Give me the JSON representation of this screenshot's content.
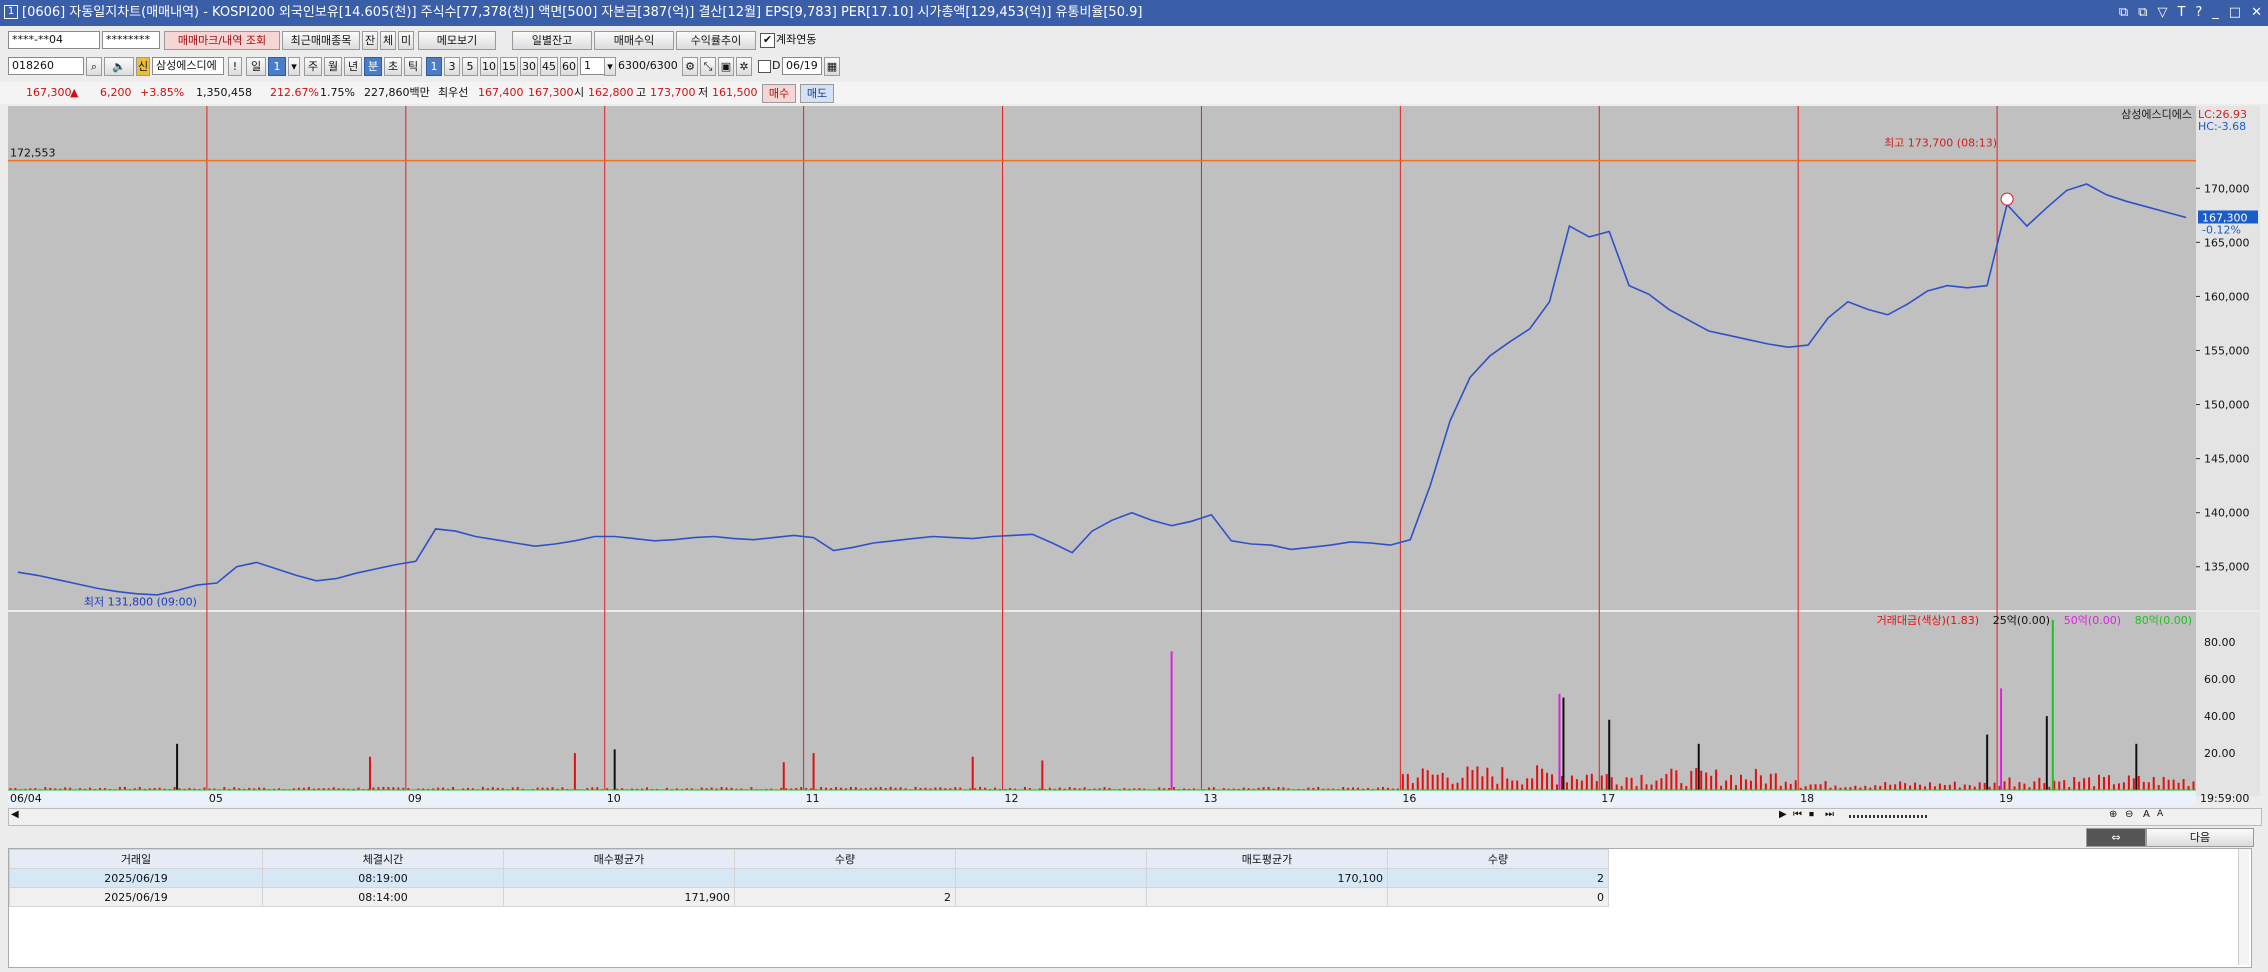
{
  "window": {
    "title": "[0606] 자동일지차트(매매내역) - KOSPI200 외국인보유[14.605(천)] 주식수[77,378(천)] 액면[500] 자본금[387(억)] 결산[12월] EPS[9,783] PER[17.10] 시가총액[129,453(억)] 유통비율[50.9]",
    "icon": "1",
    "buttons": [
      "⧉",
      "⧉",
      "▽",
      "T",
      "?",
      "_",
      "□",
      "✕"
    ]
  },
  "toolbar1": {
    "account": "****-**04",
    "password": "********",
    "buttons": [
      "매매마크/내역 조회",
      "최근매매종목",
      "잔",
      "체",
      "미",
      "메모보기",
      "일별잔고",
      "매매수익",
      "수익률추이"
    ],
    "checkbox_label": "계좌연동",
    "checkbox_checked": true
  },
  "toolbar2": {
    "code": "018260",
    "stock_name": "삼성에스디에",
    "period_buttons": [
      "일",
      "1",
      "주",
      "월",
      "년",
      "분",
      "초",
      "틱"
    ],
    "active_period": "분",
    "interval_buttons": [
      "1",
      "3",
      "5",
      "10",
      "15",
      "30",
      "45",
      "60"
    ],
    "active_interval": "1",
    "multiplier": "1",
    "count": "6300",
    "count_total": "/6300",
    "date_checkbox_label": "D",
    "date": "06/19"
  },
  "quote": {
    "price": "167,300",
    "change_arrow": "▲",
    "change": "6,200",
    "change_pct": "+3.85%",
    "volume": "1,350,458",
    "vol_ratio": "212.67%",
    "turnover": "1.75%",
    "amount": "227,860백만",
    "pre_label": "최우선",
    "ask": "167,400",
    "bid": "167,300",
    "open_label": "시",
    "open": "162,800",
    "high_label": "고",
    "high": "173,700",
    "low_label": "저",
    "low": "161,500",
    "buy_btn": "매수",
    "sell_btn": "매도"
  },
  "chart_data": [
    {
      "type": "line",
      "title": "",
      "legend": "삼성에스디에스",
      "lc": "LC:26.93",
      "hc": "HC:-3.68",
      "hline_label": "172,553",
      "hline_value": 172553,
      "current_price_label": "167,300",
      "current_change_label": "-0.12%",
      "max_label": "최고 173,700 (08:13)",
      "min_label": "최저 131,800 (09:00)",
      "ylim": [
        131000,
        176500
      ],
      "yticks": [
        170000,
        165000,
        160000,
        155000,
        150000,
        145000,
        140000,
        135000
      ],
      "ytick_labels": [
        "170,000",
        "165,000",
        "160,000",
        "155,000",
        "150,000",
        "145,000",
        "140,000",
        "135,000"
      ],
      "x_labels": [
        "06/04",
        "05",
        "09",
        "10",
        "11",
        "12",
        "13",
        "16",
        "17",
        "18",
        "19"
      ],
      "time_label": "19:59:00",
      "line_color": "#3050C8",
      "day_series": [
        {
          "day": "06/04",
          "values": [
            134500,
            134200,
            133800,
            133400,
            133000,
            132700,
            132500,
            132400,
            132800,
            133300
          ]
        },
        {
          "day": "05",
          "values": [
            133500,
            135000,
            135400,
            134800,
            134200,
            133700,
            133900,
            134400,
            134800,
            135200
          ]
        },
        {
          "day": "09",
          "values": [
            135500,
            138500,
            138300,
            137800,
            137500,
            137200,
            136900,
            137100,
            137400,
            137800
          ]
        },
        {
          "day": "10",
          "values": [
            137800,
            137600,
            137400,
            137500,
            137700,
            137800,
            137600,
            137500,
            137700,
            137900
          ]
        },
        {
          "day": "11",
          "values": [
            137700,
            136500,
            136800,
            137200,
            137400,
            137600,
            137800,
            137700,
            137600,
            137800
          ]
        },
        {
          "day": "12",
          "values": [
            137900,
            138000,
            137200,
            136300,
            138300,
            139300,
            140000,
            139300,
            138800,
            139200
          ]
        },
        {
          "day": "13",
          "values": [
            139800,
            137400,
            137100,
            137000,
            136600,
            136800,
            137000,
            137300,
            137200,
            137000
          ]
        },
        {
          "day": "16",
          "values": [
            137500,
            142500,
            148500,
            152500,
            154500,
            155800,
            157000,
            159500,
            166500,
            165500
          ]
        },
        {
          "day": "17",
          "values": [
            166000,
            161000,
            160200,
            158800,
            157800,
            156800,
            156400,
            156000,
            155600,
            155300
          ]
        },
        {
          "day": "18",
          "values": [
            155500,
            158000,
            159500,
            158800,
            158300,
            159300,
            160500,
            161000,
            160800,
            161000
          ]
        },
        {
          "day": "19",
          "values": [
            168500,
            166500,
            168200,
            169800,
            170400,
            169400,
            168800,
            168300,
            167800,
            167300
          ]
        }
      ]
    },
    {
      "type": "bar",
      "title": "",
      "legend": [
        "거래대금(색상)(1.83)",
        "25억(0.00)",
        "50억(0.00)",
        "80억(0.00)"
      ],
      "legend_colors": [
        "#E01010",
        "#111111",
        "#E020E0",
        "#20C020"
      ],
      "ylim": [
        0,
        92
      ],
      "yticks": [
        80,
        60,
        40,
        20
      ],
      "ytick_labels": [
        "80.00",
        "60.00",
        "40.00",
        "20.00"
      ],
      "spikes": [
        {
          "day_idx": 0,
          "pos": 0.85,
          "value": 25,
          "color": "#111111"
        },
        {
          "day_idx": 1,
          "pos": 0.82,
          "value": 18,
          "color": "#E01010"
        },
        {
          "day_idx": 2,
          "pos": 0.85,
          "value": 20,
          "color": "#E01010"
        },
        {
          "day_idx": 3,
          "pos": 0.05,
          "value": 22,
          "color": "#111111"
        },
        {
          "day_idx": 3,
          "pos": 0.9,
          "value": 15,
          "color": "#E01010"
        },
        {
          "day_idx": 4,
          "pos": 0.05,
          "value": 20,
          "color": "#E01010"
        },
        {
          "day_idx": 4,
          "pos": 0.85,
          "value": 18,
          "color": "#E01010"
        },
        {
          "day_idx": 5,
          "pos": 0.2,
          "value": 16,
          "color": "#E01010"
        },
        {
          "day_idx": 5,
          "pos": 0.85,
          "value": 75,
          "color": "#E020E0"
        },
        {
          "day_idx": 7,
          "pos": 0.8,
          "value": 52,
          "color": "#E020E0"
        },
        {
          "day_idx": 7,
          "pos": 0.82,
          "value": 50,
          "color": "#111111"
        },
        {
          "day_idx": 8,
          "pos": 0.05,
          "value": 38,
          "color": "#111111"
        },
        {
          "day_idx": 8,
          "pos": 0.5,
          "value": 25,
          "color": "#111111"
        },
        {
          "day_idx": 9,
          "pos": 0.95,
          "value": 30,
          "color": "#111111"
        },
        {
          "day_idx": 10,
          "pos": 0.02,
          "value": 55,
          "color": "#E020E0"
        },
        {
          "day_idx": 10,
          "pos": 0.28,
          "value": 92,
          "color": "#20C020"
        },
        {
          "day_idx": 10,
          "pos": 0.25,
          "value": 40,
          "color": "#111111"
        },
        {
          "day_idx": 10,
          "pos": 0.7,
          "value": 25,
          "color": "#111111"
        }
      ],
      "base_level": [
        1,
        1,
        1,
        1,
        1,
        1,
        1,
        8,
        7,
        3,
        5
      ]
    }
  ],
  "scrollbar": {
    "buttons": [
      "◀",
      "▶",
      "⏮",
      "⏹",
      "⏭",
      "⊕",
      "⊖",
      "A",
      "A"
    ]
  },
  "bottom": {
    "toggle_btn": "⇔",
    "next_btn": "다음",
    "headers": [
      "거래일",
      "체결시간",
      "매수평균가",
      "수량",
      "",
      "매도평균가",
      "수량"
    ],
    "rows": [
      [
        "2025/06/19",
        "08:19:00",
        "",
        "",
        "",
        "170,100",
        "2"
      ],
      [
        "2025/06/19",
        "08:14:00",
        "171,900",
        "2",
        "",
        "",
        "0"
      ]
    ]
  }
}
